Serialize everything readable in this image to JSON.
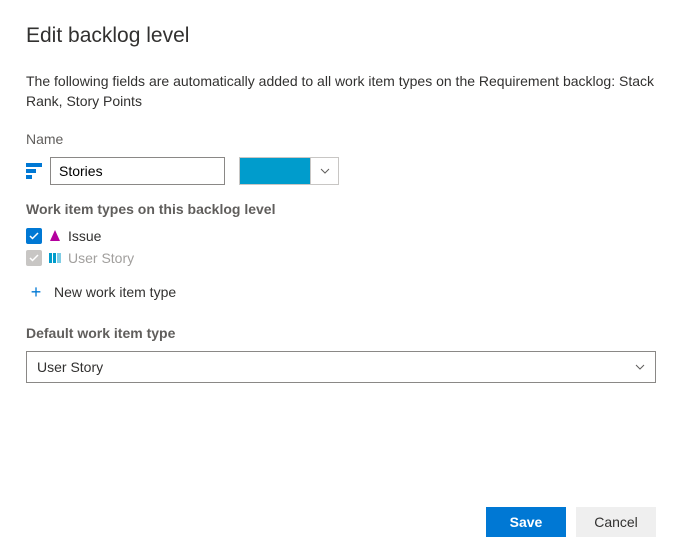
{
  "dialog": {
    "title": "Edit backlog level",
    "intro": "The following fields are automatically added to all work item types on the Requirement backlog: Stack Rank, Story Points"
  },
  "name": {
    "label": "Name",
    "value": "Stories",
    "color": "#009ccc"
  },
  "workItemTypes": {
    "label": "Work item types on this backlog level",
    "items": [
      {
        "name": "Issue",
        "checked": true,
        "disabled": false,
        "icon": "issue",
        "iconColor": "#b4009e"
      },
      {
        "name": "User Story",
        "checked": true,
        "disabled": true,
        "icon": "userstory",
        "iconColor": "#009ccc"
      }
    ],
    "newLabel": "New work item type"
  },
  "defaultType": {
    "label": "Default work item type",
    "value": "User Story"
  },
  "buttons": {
    "save": "Save",
    "cancel": "Cancel"
  }
}
